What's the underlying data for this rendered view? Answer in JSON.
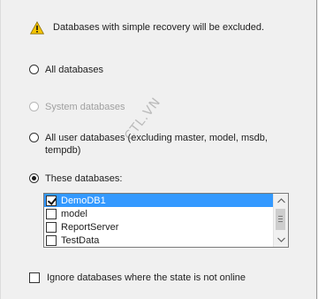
{
  "warning": {
    "icon": "warning-triangle-icon",
    "text": "Databases with simple recovery will be excluded."
  },
  "options": [
    {
      "label": "All databases",
      "selected": false,
      "enabled": true
    },
    {
      "label": "System databases",
      "selected": false,
      "enabled": false
    },
    {
      "label": "All user databases  (excluding master, model, msdb,",
      "label2": "tempdb)",
      "selected": false,
      "enabled": true
    },
    {
      "label": "These databases:",
      "selected": true,
      "enabled": true
    }
  ],
  "database_list": {
    "items": [
      {
        "name": "DemoDB1",
        "checked": true,
        "selected": true
      },
      {
        "name": "model",
        "checked": false,
        "selected": false
      },
      {
        "name": "ReportServer",
        "checked": false,
        "selected": false
      },
      {
        "name": "TestData",
        "checked": false,
        "selected": false
      }
    ]
  },
  "ignore_offline": {
    "label": "Ignore databases where the state is not online",
    "checked": false
  },
  "watermark": "CTL.VN",
  "colors": {
    "selection": "#3399ff",
    "background": "#f0f0f0",
    "warning": "#f5c400"
  }
}
